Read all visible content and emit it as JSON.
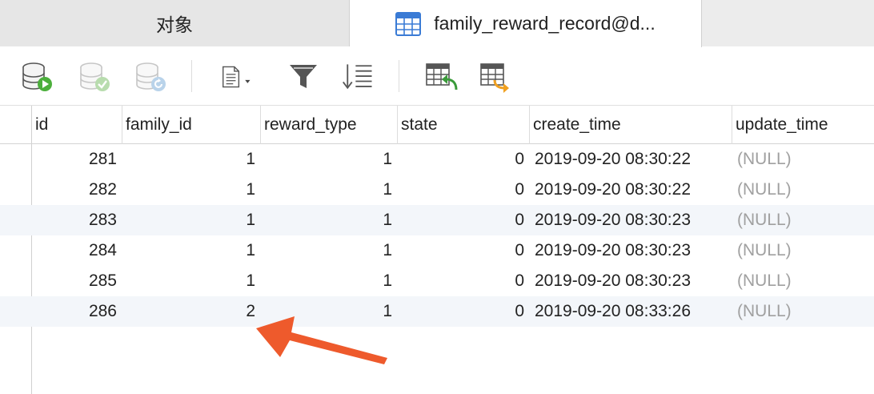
{
  "tabs": [
    {
      "label": "对象",
      "active": false
    },
    {
      "label": "family_reward_record@d...",
      "active": true
    }
  ],
  "toolbar": {
    "icons": [
      "db-run-icon",
      "db-commit-icon",
      "db-refresh-icon",
      "document-menu-icon",
      "filter-icon",
      "sort-icon",
      "import-table-icon",
      "export-table-icon"
    ]
  },
  "table": {
    "columns": [
      "id",
      "family_id",
      "reward_type",
      "state",
      "create_time",
      "update_time"
    ],
    "rows": [
      {
        "id": "281",
        "family_id": "1",
        "reward_type": "1",
        "state": "0",
        "create_time": "2019-09-20 08:30:22",
        "update_time": "(NULL)"
      },
      {
        "id": "282",
        "family_id": "1",
        "reward_type": "1",
        "state": "0",
        "create_time": "2019-09-20 08:30:22",
        "update_time": "(NULL)"
      },
      {
        "id": "283",
        "family_id": "1",
        "reward_type": "1",
        "state": "0",
        "create_time": "2019-09-20 08:30:23",
        "update_time": "(NULL)"
      },
      {
        "id": "284",
        "family_id": "1",
        "reward_type": "1",
        "state": "0",
        "create_time": "2019-09-20 08:30:23",
        "update_time": "(NULL)"
      },
      {
        "id": "285",
        "family_id": "1",
        "reward_type": "1",
        "state": "0",
        "create_time": "2019-09-20 08:30:23",
        "update_time": "(NULL)"
      },
      {
        "id": "286",
        "family_id": "2",
        "reward_type": "1",
        "state": "0",
        "create_time": "2019-09-20 08:33:26",
        "update_time": "(NULL)"
      }
    ]
  },
  "colors": {
    "annotation_arrow": "#ee5a2c",
    "row_stripe": "#f3f6fa",
    "null_text": "#a0a0a0"
  }
}
